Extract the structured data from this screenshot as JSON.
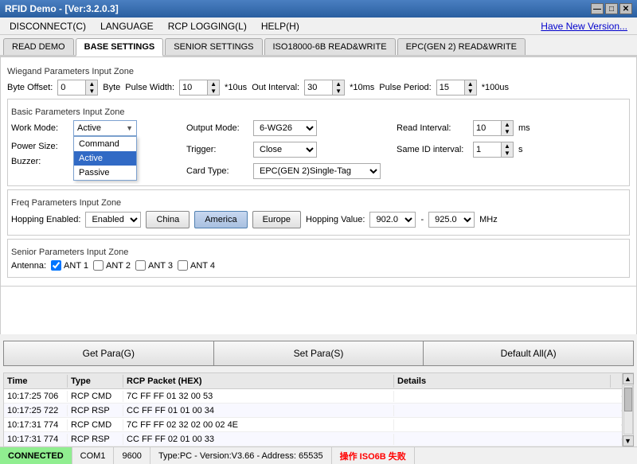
{
  "titleBar": {
    "title": "RFID Demo - [Ver:3.2.0.3]",
    "minBtn": "—",
    "maxBtn": "□",
    "closeBtn": "✕"
  },
  "menuBar": {
    "items": [
      {
        "label": "DISCONNECT(C)"
      },
      {
        "label": "LANGUAGE"
      },
      {
        "label": "RCP LOGGING(L)"
      },
      {
        "label": "HELP(H)"
      }
    ],
    "linkText": "Have New Version..."
  },
  "tabs": [
    {
      "label": "READ DEMO",
      "active": false
    },
    {
      "label": "BASE SETTINGS",
      "active": true
    },
    {
      "label": "SENIOR SETTINGS",
      "active": false
    },
    {
      "label": "ISO18000-6B READ&WRITE",
      "active": false
    },
    {
      "label": "EPC(GEN 2) READ&WRITE",
      "active": false
    }
  ],
  "wiegandSection": {
    "title": "Wiegand Parameters Input Zone",
    "byteOffsetLabel": "Byte Offset:",
    "byteOffsetValue": "0",
    "byteLabel": "Byte",
    "pulseWidthLabel": "Pulse Width:",
    "pulseWidthValue": "10",
    "pulseWidthUnit": "*10us",
    "outIntervalLabel": "Out Interval:",
    "outIntervalValue": "30",
    "outIntervalUnit": "*10ms",
    "pulsePeriodLabel": "Pulse Period:",
    "pulsePeriodValue": "15",
    "pulsePeriodUnit": "*100us"
  },
  "basicSection": {
    "title": "Basic Parameters Input Zone",
    "workModeLabel": "Work Mode:",
    "workModeValue": "Active",
    "workModeOptions": [
      "Command",
      "Active",
      "Passive"
    ],
    "dropdownOpen": true,
    "dropdownItems": [
      {
        "label": "Command",
        "selected": false
      },
      {
        "label": "Active",
        "selected": true
      },
      {
        "label": "Passive",
        "selected": false
      }
    ],
    "powerSizeLabel": "Power Size:",
    "buzzerLabel": "Buzzer:",
    "outputModeLabel": "Output Mode:",
    "outputModeValue": "6-WG26",
    "triggerLabel": "Trigger:",
    "triggerValue": "Close",
    "readIntervalLabel": "Read Interval:",
    "readIntervalValue": "10",
    "readIntervalUnit": "ms",
    "sameIdLabel": "Same ID interval:",
    "sameIdValue": "1",
    "sameIdUnit": "s",
    "cardTypeLabel": "Card Type:",
    "cardTypeValue": "EPC(GEN 2)Single-Tag"
  },
  "freqSection": {
    "title": "Freq Parameters Input Zone",
    "hoppingLabel": "Hopping Enabled:",
    "hoppingValue": "Enabled",
    "chinaBtn": "China",
    "americaBtn": "America",
    "europeBtn": "Europe",
    "hoppingValueLabel": "Hopping Value:",
    "freqMin": "902.0",
    "freqMax": "925.0",
    "freqUnit": "MHz"
  },
  "seniorSection": {
    "title": "Senior Parameters Input Zone",
    "antennaLabel": "Antenna:",
    "ant1Label": "ANT 1",
    "ant2Label": "ANT 2",
    "ant3Label": "ANT 3",
    "ant4Label": "ANT 4",
    "ant1Checked": true,
    "ant2Checked": false,
    "ant3Checked": false,
    "ant4Checked": false
  },
  "actionButtons": {
    "getParaBtn": "Get Para(G)",
    "setParaBtn": "Set Para(S)",
    "defaultAllBtn": "Default All(A)"
  },
  "logTable": {
    "headers": [
      "Time",
      "Type",
      "RCP Packet (HEX)",
      "Details"
    ],
    "rows": [
      {
        "time": "10:17:25 706",
        "type": "RCP CMD",
        "rcp": "7C FF FF 01 32 00 53",
        "details": ""
      },
      {
        "time": "10:17:25 722",
        "type": "RCP RSP",
        "rcp": "CC FF FF 01 01 00 34",
        "details": ""
      },
      {
        "time": "10:17:31 774",
        "type": "RCP CMD",
        "rcp": "7C FF FF 02 32 02 00 02 4E",
        "details": ""
      },
      {
        "time": "10:17:31 774",
        "type": "RCP RSP",
        "rcp": "CC FF FF 02 01 00 33",
        "details": ""
      }
    ]
  },
  "statusBar": {
    "connected": "CONNECTED",
    "port": "COM1",
    "baud": "9600",
    "version": "Type:PC - Version:V3.66 - Address: 65535",
    "error": "操作 ISO6B 失败"
  }
}
